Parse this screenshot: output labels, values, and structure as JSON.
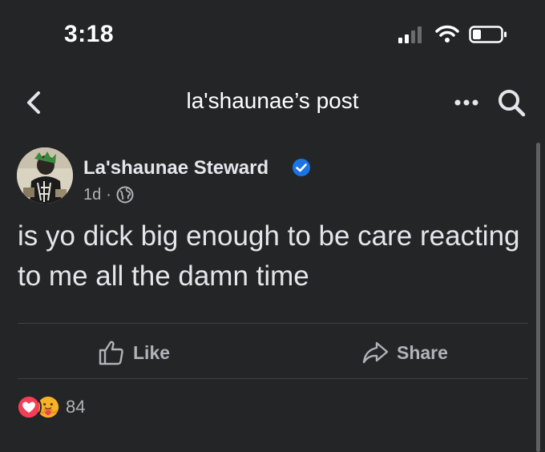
{
  "status_bar": {
    "time": "3:18"
  },
  "nav": {
    "title": "la'shaunae’s post",
    "icons": [
      "chevron-left-icon",
      "more-dots-icon",
      "search-icon"
    ]
  },
  "post": {
    "author": "La'shaunae Steward",
    "verified": true,
    "time_ago": "1d",
    "meta_separator": "·",
    "audience_icon": "globe-icon",
    "text": "is yo dick big enough to be care reacting to me all the damn time"
  },
  "actions": {
    "like_label": "Like",
    "share_label": "Share"
  },
  "reactions": {
    "types": [
      "love",
      "care"
    ],
    "count": "84"
  },
  "colors": {
    "background": "#242526",
    "primary_text": "#e4e6eb",
    "secondary_text": "#b0b3b8",
    "verified_blue": "#1b74e4",
    "love_red": "#f33e58",
    "care_yellow": "#f7b125"
  }
}
